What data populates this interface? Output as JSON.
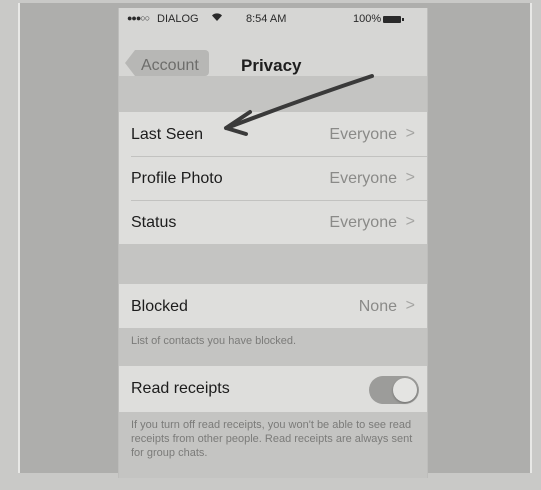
{
  "status_bar": {
    "signal_dots": "●●●○○",
    "carrier": "DIALOG",
    "wifi_icon": "wifi-icon",
    "time": "8:54 AM",
    "battery": "100%"
  },
  "nav": {
    "back_label": "Account",
    "title": "Privacy"
  },
  "privacy_group": [
    {
      "label": "Last Seen",
      "value": "Everyone",
      "chevron": ">"
    },
    {
      "label": "Profile Photo",
      "value": "Everyone",
      "chevron": ">"
    },
    {
      "label": "Status",
      "value": "Everyone",
      "chevron": ">"
    }
  ],
  "blocked": {
    "label": "Blocked",
    "value": "None",
    "chevron": ">",
    "footnote": "List of contacts you have blocked."
  },
  "read_receipts": {
    "label": "Read receipts",
    "enabled": true,
    "footnote": "If you turn off read receipts, you won't be able to see read receipts from other people. Read receipts are always sent for group chats."
  },
  "annotation": {
    "arrow_color": "#3a3a3a"
  }
}
